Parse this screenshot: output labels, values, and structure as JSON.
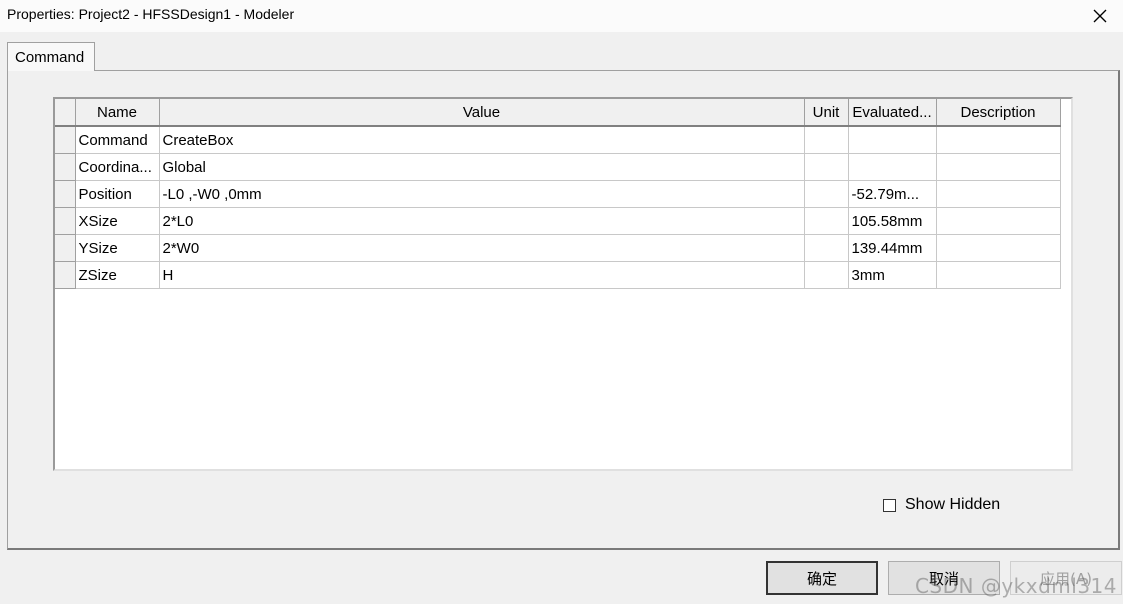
{
  "window": {
    "title": "Properties: Project2 - HFSSDesign1 - Modeler"
  },
  "tabs": [
    {
      "label": "Command"
    }
  ],
  "table": {
    "columns": [
      "Name",
      "Value",
      "Unit",
      "Evaluated...",
      "Description"
    ],
    "rows": [
      {
        "name": "Command",
        "value": "CreateBox",
        "unit": "",
        "evaluated": "",
        "description": ""
      },
      {
        "name": "Coordina...",
        "value": "Global",
        "unit": "",
        "evaluated": "",
        "description": ""
      },
      {
        "name": "Position",
        "value": "-L0 ,-W0 ,0mm",
        "unit": "",
        "evaluated": "-52.79m...",
        "description": ""
      },
      {
        "name": "XSize",
        "value": "2*L0",
        "unit": "",
        "evaluated": "105.58mm",
        "description": ""
      },
      {
        "name": "YSize",
        "value": "2*W0",
        "unit": "",
        "evaluated": "139.44mm",
        "description": ""
      },
      {
        "name": "ZSize",
        "value": "H",
        "unit": "",
        "evaluated": "3mm",
        "description": ""
      }
    ]
  },
  "show_hidden": {
    "label": "Show Hidden",
    "checked": false
  },
  "buttons": {
    "ok": "确定",
    "cancel": "取消",
    "apply": "应用(A)"
  },
  "watermark": "CSDN @ykxdml314",
  "icons": {
    "close": "close-icon"
  }
}
